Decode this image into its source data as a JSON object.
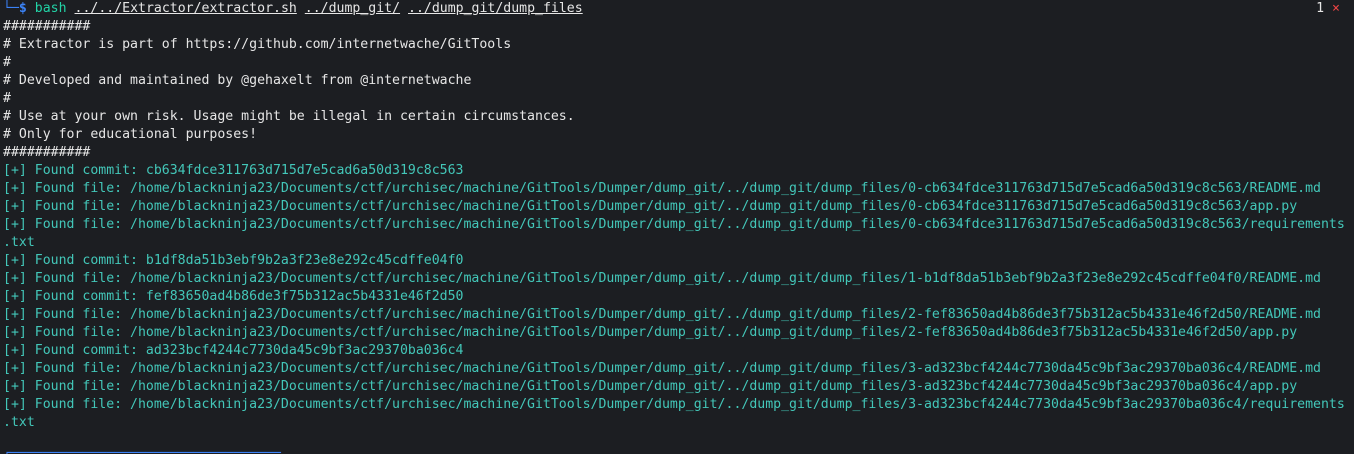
{
  "prompt": {
    "corner": "└─",
    "symbol": "$",
    "command": "bash",
    "args": [
      "../../Extractor/extractor.sh",
      "../dump_git/",
      "../dump_git/dump_files"
    ]
  },
  "status": {
    "count": "1",
    "error_icon": "×"
  },
  "banner": [
    "###########",
    "# Extractor is part of https://github.com/internetwache/GitTools",
    "#",
    "# Developed and maintained by @gehaxelt from @internetwache",
    "#",
    "# Use at your own risk. Usage might be illegal in certain circumstances.",
    "# Only for educational purposes!",
    "###########"
  ],
  "output": [
    "[+] Found commit: cb634fdce311763d715d7e5cad6a50d319c8c563",
    "[+] Found file: /home/blackninja23/Documents/ctf/urchisec/machine/GitTools/Dumper/dump_git/../dump_git/dump_files/0-cb634fdce311763d715d7e5cad6a50d319c8c563/README.md",
    "[+] Found file: /home/blackninja23/Documents/ctf/urchisec/machine/GitTools/Dumper/dump_git/../dump_git/dump_files/0-cb634fdce311763d715d7e5cad6a50d319c8c563/app.py",
    "[+] Found file: /home/blackninja23/Documents/ctf/urchisec/machine/GitTools/Dumper/dump_git/../dump_git/dump_files/0-cb634fdce311763d715d7e5cad6a50d319c8c563/requirements",
    ".txt",
    "[+] Found commit: b1df8da51b3ebf9b2a3f23e8e292c45cdffe04f0",
    "[+] Found file: /home/blackninja23/Documents/ctf/urchisec/machine/GitTools/Dumper/dump_git/../dump_git/dump_files/1-b1df8da51b3ebf9b2a3f23e8e292c45cdffe04f0/README.md",
    "[+] Found commit: fef83650ad4b86de3f75b312ac5b4331e46f2d50",
    "[+] Found file: /home/blackninja23/Documents/ctf/urchisec/machine/GitTools/Dumper/dump_git/../dump_git/dump_files/2-fef83650ad4b86de3f75b312ac5b4331e46f2d50/README.md",
    "[+] Found file: /home/blackninja23/Documents/ctf/urchisec/machine/GitTools/Dumper/dump_git/../dump_git/dump_files/2-fef83650ad4b86de3f75b312ac5b4331e46f2d50/app.py",
    "[+] Found commit: ad323bcf4244c7730da45c9bf3ac29370ba036c4",
    "[+] Found file: /home/blackninja23/Documents/ctf/urchisec/machine/GitTools/Dumper/dump_git/../dump_git/dump_files/3-ad323bcf4244c7730da45c9bf3ac29370ba036c4/README.md",
    "[+] Found file: /home/blackninja23/Documents/ctf/urchisec/machine/GitTools/Dumper/dump_git/../dump_git/dump_files/3-ad323bcf4244c7730da45c9bf3ac29370ba036c4/app.py",
    "[+] Found file: /home/blackninja23/Documents/ctf/urchisec/machine/GitTools/Dumper/dump_git/../dump_git/dump_files/3-ad323bcf4244c7730da45c9bf3ac29370ba036c4/requirements",
    ".txt"
  ],
  "colors": {
    "background": "#1c1e22",
    "text": "#e6e6e6",
    "found": "#43c7b9",
    "prompt": "#3b82f6",
    "command": "#22d3a6",
    "error": "#ef4444"
  }
}
